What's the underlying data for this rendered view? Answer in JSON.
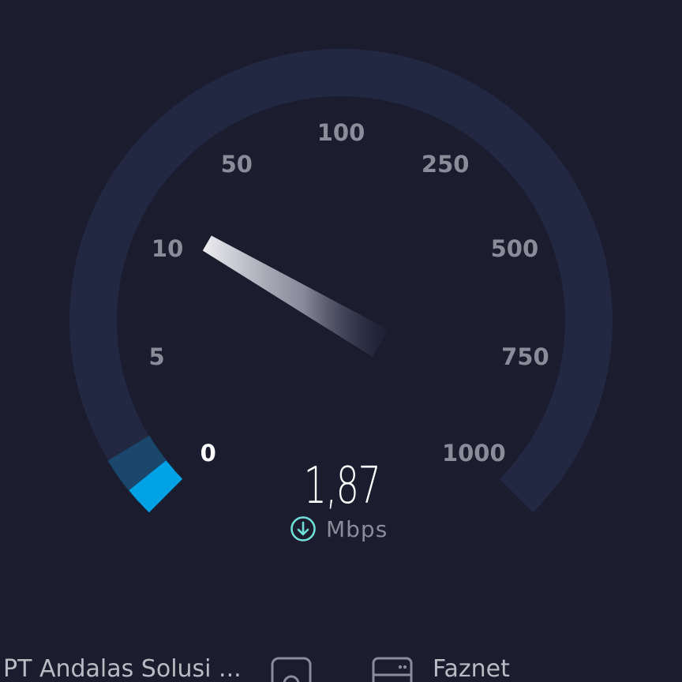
{
  "gauge": {
    "scale_labels": [
      "0",
      "5",
      "10",
      "50",
      "100",
      "250",
      "500",
      "750",
      "1000"
    ],
    "active_label": "0",
    "current_speed": 1.87,
    "track_color": "#232842",
    "progress_color": "#00a2e6",
    "needle_color": "#e6e6ec"
  },
  "readout": {
    "value": "1,87",
    "unit": "Mbps",
    "direction_icon": "download-arrow-icon",
    "icon_color": "#6fe0d8"
  },
  "footer": {
    "isp_name": "PT Andalas Solusi ...",
    "user_icon": "user-icon",
    "server_icon": "server-icon",
    "server_name": "Faznet"
  }
}
